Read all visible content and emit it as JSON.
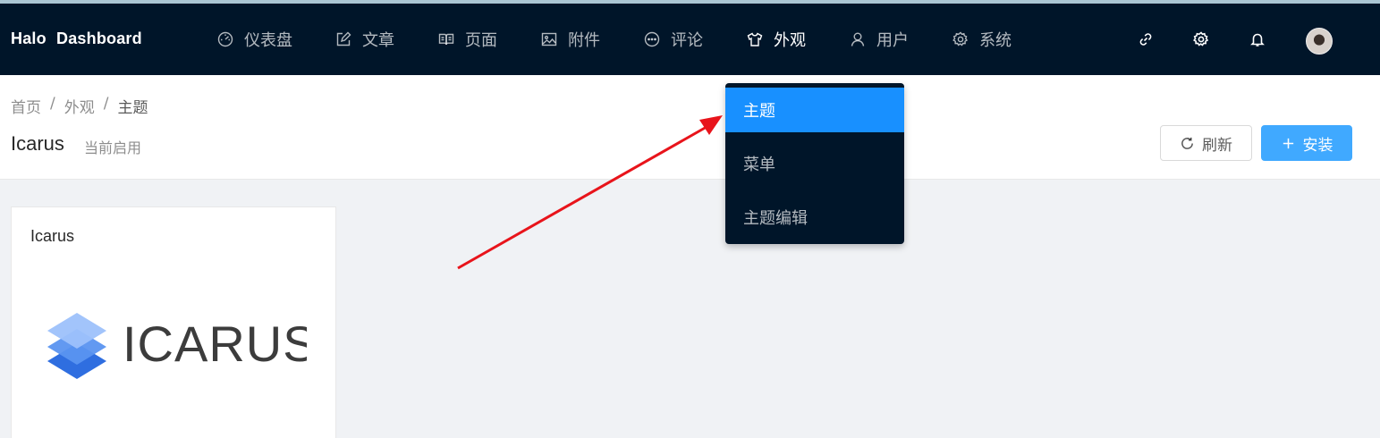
{
  "brand": "Halo  Dashboard",
  "nav": {
    "items": [
      {
        "label": "仪表盘",
        "icon": "dashboard-icon"
      },
      {
        "label": "文章",
        "icon": "edit-icon"
      },
      {
        "label": "页面",
        "icon": "read-icon"
      },
      {
        "label": "附件",
        "icon": "picture-icon"
      },
      {
        "label": "评论",
        "icon": "message-icon"
      },
      {
        "label": "外观",
        "icon": "skin-icon"
      },
      {
        "label": "用户",
        "icon": "user-icon"
      },
      {
        "label": "系统",
        "icon": "setting-icon"
      }
    ],
    "active": "外观",
    "right_icons": [
      "link-icon",
      "setting-icon",
      "bell-icon",
      "avatar"
    ]
  },
  "dropdown": {
    "items": [
      "主题",
      "菜单",
      "主题编辑"
    ],
    "selected": "主题"
  },
  "breadcrumb": [
    "首页",
    "外观",
    "主题"
  ],
  "breadcrumb_separator": "/",
  "page": {
    "title": "Icarus",
    "subtitle": "当前启用",
    "refresh_label": "刷新",
    "install_label": "安装"
  },
  "theme_card": {
    "title": "Icarus",
    "logo_text": "ICARUS"
  },
  "colors": {
    "nav_bg": "#001529",
    "primary": "#1890ff",
    "install_button": "#40a9ff",
    "annotation_arrow": "#e8141b",
    "content_bg": "#f0f2f5"
  }
}
